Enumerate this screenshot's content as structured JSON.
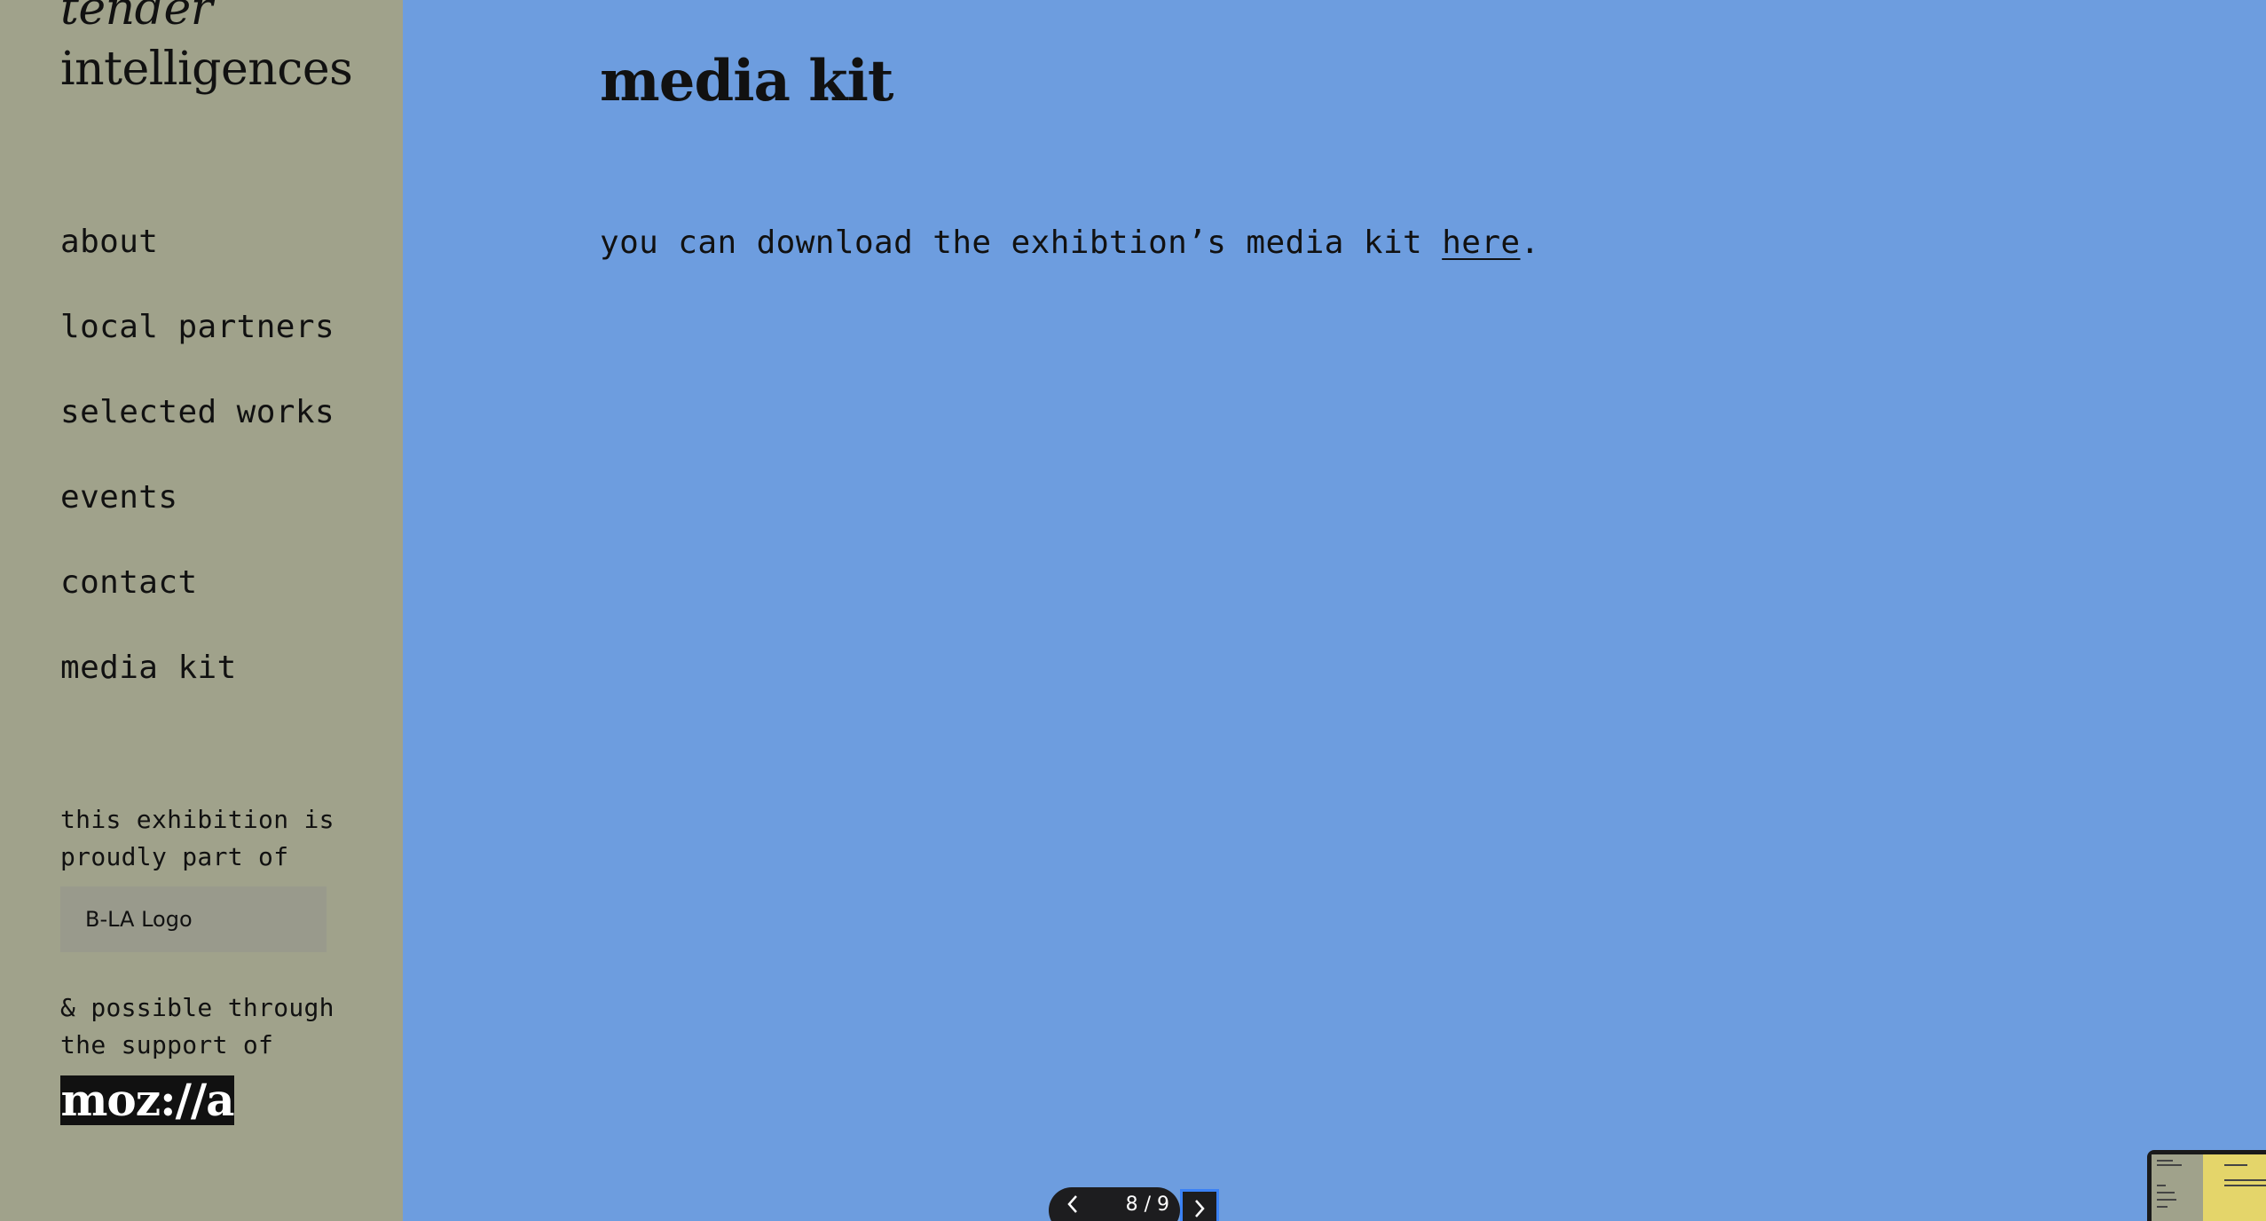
{
  "sidebar": {
    "title_line1": "tender",
    "title_line2": "intelligences",
    "nav": [
      {
        "label": "about"
      },
      {
        "label": "local partners"
      },
      {
        "label": "selected works"
      },
      {
        "label": "events"
      },
      {
        "label": "contact"
      },
      {
        "label": "media kit"
      }
    ],
    "support_line1": "this exhibition is\nproudly part of",
    "bla_logo_alt": "B-LA Logo",
    "support_line2": "& possible through\nthe support of",
    "mozilla_logo_text": "moz://a"
  },
  "main": {
    "title": "media kit",
    "body_prefix": "you can download the exhibtion’s media kit ",
    "link_text": "here",
    "body_suffix": "."
  },
  "pager": {
    "counter": "8 / 9",
    "prev_icon": "chevron-left-icon",
    "next_icon": "chevron-right-icon"
  },
  "colors": {
    "sidebar_bg": "#a0a28b",
    "main_bg": "#6d9ddf",
    "text": "#111111",
    "pager_bg": "#1d1d1f",
    "focus_ring": "#3b82f6",
    "thumb_accent": "#e4d56a"
  }
}
